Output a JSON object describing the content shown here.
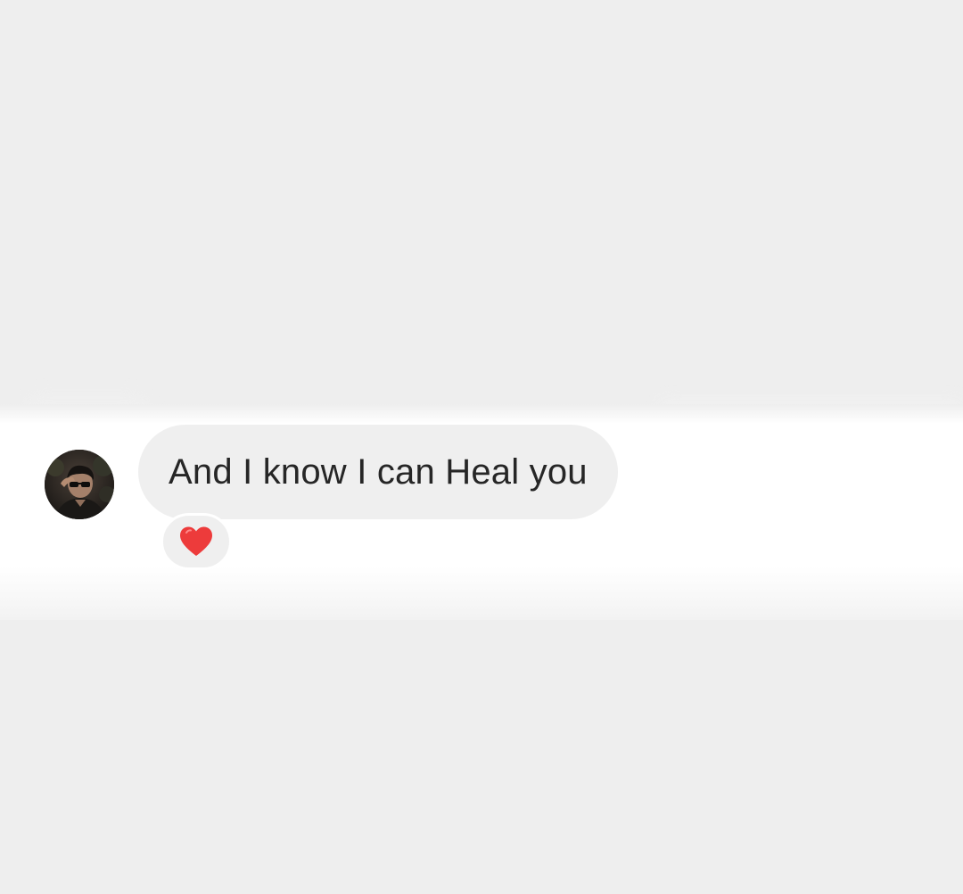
{
  "message": {
    "text": "And I know I can Heal you",
    "bubble_color": "#efefef",
    "text_color": "#262626"
  },
  "reaction": {
    "icon": "red-heart-icon",
    "color": "#ed4956"
  },
  "avatar": {
    "icon": "profile-avatar"
  },
  "colors": {
    "background": "#eeeeee",
    "chat_background": "#ffffff"
  }
}
